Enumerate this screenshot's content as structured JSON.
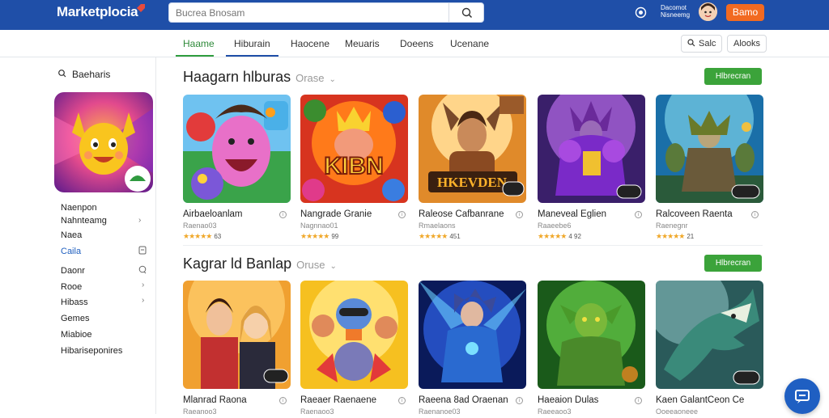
{
  "app": {
    "logo": "Marketplocia"
  },
  "search": {
    "placeholder": "Bucrea Bnosam"
  },
  "header": {
    "account_line1": "Dacomot",
    "account_line2": "Nisneemg",
    "cta": "Bamo"
  },
  "tabs": [
    {
      "label": "Haame",
      "active": true
    },
    {
      "label": "Hiburain",
      "active": false
    },
    {
      "label": "Haocene",
      "active": false
    },
    {
      "label": "Meuaris",
      "active": false
    },
    {
      "label": "Doeens",
      "active": false
    },
    {
      "label": "Ucenane",
      "active": false
    }
  ],
  "toolbar": {
    "search_label": "Salc",
    "sort_label": "Alooks"
  },
  "sidebar": {
    "heading": "Baeharis",
    "items": [
      {
        "label": "Naenpon",
        "icon": ""
      },
      {
        "label": "Nahnteamg",
        "icon": "chevron"
      },
      {
        "label": "Naea",
        "icon": ""
      },
      {
        "label": "Caila",
        "icon": "doc",
        "highlight": true
      },
      {
        "label": "Daonr",
        "icon": "chat"
      },
      {
        "label": "Rooe",
        "icon": "chevron"
      },
      {
        "label": "Hibass",
        "icon": "chevron"
      },
      {
        "label": "Gemes",
        "icon": ""
      },
      {
        "label": "Miabioe",
        "icon": ""
      },
      {
        "label": "Hibariseponires",
        "icon": ""
      }
    ]
  },
  "sections": [
    {
      "title": "Haagarn hlburas",
      "subtitle": "Orase",
      "button": "Hlbrecran",
      "cards": [
        {
          "title": "Airbaeloanlam",
          "sub": "Raenao03",
          "rating": "63"
        },
        {
          "title": "Nangrade Granie",
          "sub": "Nagnnao01",
          "rating": "99"
        },
        {
          "title": "Raleose Cafbanrane",
          "sub": "Rmaelaons",
          "rating": "451"
        },
        {
          "title": "Maneveal Eglien",
          "sub": "Raaeebe6",
          "rating": "4 92"
        },
        {
          "title": "Ralcoveen Raenta",
          "sub": "Raenegnr",
          "rating": "21"
        }
      ]
    },
    {
      "title": "Kagrar ld Banlap",
      "subtitle": "Oruse",
      "button": "Hlbrecran",
      "cards": [
        {
          "title": "Mlanrad Raona",
          "sub": "Raeanoo3",
          "rating": ""
        },
        {
          "title": "Raeaer Raenaene",
          "sub": "Raenaoo3",
          "rating": ""
        },
        {
          "title": "Raeena 8ad Oraenan",
          "sub": "Raenanoe03",
          "rating": ""
        },
        {
          "title": "Haeaion Dulas",
          "sub": "Raeeaoo3",
          "rating": ""
        },
        {
          "title": "Kaen GalantCeon Ce",
          "sub": "Ooeeaoneee",
          "rating": ""
        }
      ]
    }
  ],
  "colors": {
    "brand": "#1f4fa8",
    "accent": "#f26a21",
    "success": "#3ba33a"
  }
}
